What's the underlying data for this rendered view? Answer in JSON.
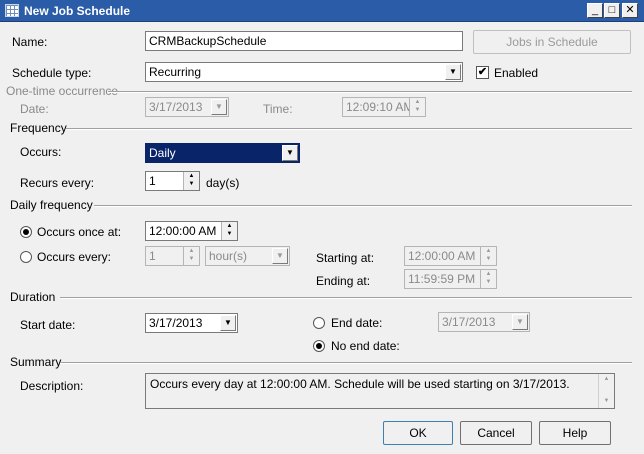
{
  "window": {
    "title": "New Job Schedule",
    "min": "_",
    "max": "□",
    "close": "✕"
  },
  "general": {
    "name_label": "Name:",
    "name_value": "CRMBackupSchedule",
    "jobs_button": "Jobs in Schedule",
    "schedule_type_label": "Schedule type:",
    "schedule_type_value": "Recurring",
    "enabled_label": "Enabled",
    "enabled_check": "✔"
  },
  "one_time": {
    "header": "One-time occurrence",
    "date_label": "Date:",
    "date_value": "3/17/2013",
    "time_label": "Time:",
    "time_value": "12:09:10 AM"
  },
  "frequency": {
    "header": "Frequency",
    "occurs_label": "Occurs:",
    "occurs_value": "Daily",
    "recurs_label": "Recurs every:",
    "recurs_value": "1",
    "recurs_unit": "day(s)"
  },
  "daily": {
    "header": "Daily frequency",
    "once_label": "Occurs once at:",
    "once_value": "12:00:00 AM",
    "every_label": "Occurs every:",
    "every_value": "1",
    "every_unit": "hour(s)",
    "starting_label": "Starting at:",
    "starting_value": "12:00:00 AM",
    "ending_label": "Ending at:",
    "ending_value": "11:59:59 PM"
  },
  "duration": {
    "header": "Duration",
    "start_label": "Start date:",
    "start_value": "3/17/2013",
    "end_label": "End date:",
    "end_value": "3/17/2013",
    "no_end_label": "No end date:"
  },
  "summary": {
    "header": "Summary",
    "desc_label": "Description:",
    "desc_value": "Occurs every day at 12:00:00 AM. Schedule will be used starting on 3/17/2013."
  },
  "buttons": {
    "ok": "OK",
    "cancel": "Cancel",
    "help": "Help"
  },
  "glyphs": {
    "dropdown": "▼",
    "spin_up": "▲",
    "spin_down": "▼"
  }
}
